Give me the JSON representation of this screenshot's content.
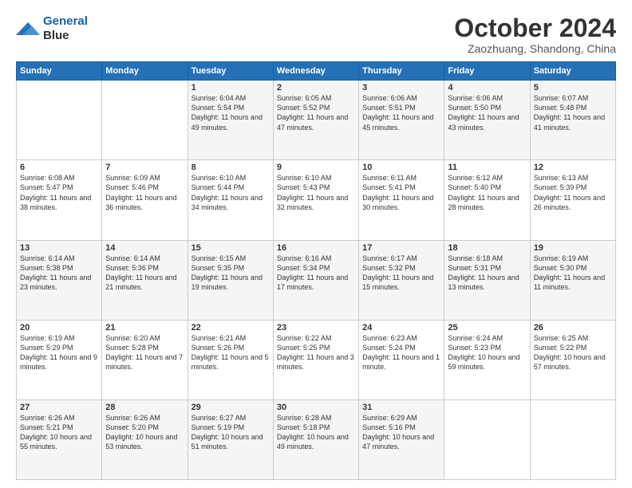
{
  "header": {
    "logo_line1": "General",
    "logo_line2": "Blue",
    "month": "October 2024",
    "location": "Zaozhuang, Shandong, China"
  },
  "weekdays": [
    "Sunday",
    "Monday",
    "Tuesday",
    "Wednesday",
    "Thursday",
    "Friday",
    "Saturday"
  ],
  "weeks": [
    [
      {
        "day": "",
        "info": ""
      },
      {
        "day": "",
        "info": ""
      },
      {
        "day": "1",
        "info": "Sunrise: 6:04 AM\nSunset: 5:54 PM\nDaylight: 11 hours and 49 minutes."
      },
      {
        "day": "2",
        "info": "Sunrise: 6:05 AM\nSunset: 5:52 PM\nDaylight: 11 hours and 47 minutes."
      },
      {
        "day": "3",
        "info": "Sunrise: 6:06 AM\nSunset: 5:51 PM\nDaylight: 11 hours and 45 minutes."
      },
      {
        "day": "4",
        "info": "Sunrise: 6:06 AM\nSunset: 5:50 PM\nDaylight: 11 hours and 43 minutes."
      },
      {
        "day": "5",
        "info": "Sunrise: 6:07 AM\nSunset: 5:48 PM\nDaylight: 11 hours and 41 minutes."
      }
    ],
    [
      {
        "day": "6",
        "info": "Sunrise: 6:08 AM\nSunset: 5:47 PM\nDaylight: 11 hours and 38 minutes."
      },
      {
        "day": "7",
        "info": "Sunrise: 6:09 AM\nSunset: 5:46 PM\nDaylight: 11 hours and 36 minutes."
      },
      {
        "day": "8",
        "info": "Sunrise: 6:10 AM\nSunset: 5:44 PM\nDaylight: 11 hours and 34 minutes."
      },
      {
        "day": "9",
        "info": "Sunrise: 6:10 AM\nSunset: 5:43 PM\nDaylight: 11 hours and 32 minutes."
      },
      {
        "day": "10",
        "info": "Sunrise: 6:11 AM\nSunset: 5:41 PM\nDaylight: 11 hours and 30 minutes."
      },
      {
        "day": "11",
        "info": "Sunrise: 6:12 AM\nSunset: 5:40 PM\nDaylight: 11 hours and 28 minutes."
      },
      {
        "day": "12",
        "info": "Sunrise: 6:13 AM\nSunset: 5:39 PM\nDaylight: 11 hours and 26 minutes."
      }
    ],
    [
      {
        "day": "13",
        "info": "Sunrise: 6:14 AM\nSunset: 5:38 PM\nDaylight: 11 hours and 23 minutes."
      },
      {
        "day": "14",
        "info": "Sunrise: 6:14 AM\nSunset: 5:36 PM\nDaylight: 11 hours and 21 minutes."
      },
      {
        "day": "15",
        "info": "Sunrise: 6:15 AM\nSunset: 5:35 PM\nDaylight: 11 hours and 19 minutes."
      },
      {
        "day": "16",
        "info": "Sunrise: 6:16 AM\nSunset: 5:34 PM\nDaylight: 11 hours and 17 minutes."
      },
      {
        "day": "17",
        "info": "Sunrise: 6:17 AM\nSunset: 5:32 PM\nDaylight: 11 hours and 15 minutes."
      },
      {
        "day": "18",
        "info": "Sunrise: 6:18 AM\nSunset: 5:31 PM\nDaylight: 11 hours and 13 minutes."
      },
      {
        "day": "19",
        "info": "Sunrise: 6:19 AM\nSunset: 5:30 PM\nDaylight: 11 hours and 11 minutes."
      }
    ],
    [
      {
        "day": "20",
        "info": "Sunrise: 6:19 AM\nSunset: 5:29 PM\nDaylight: 11 hours and 9 minutes."
      },
      {
        "day": "21",
        "info": "Sunrise: 6:20 AM\nSunset: 5:28 PM\nDaylight: 11 hours and 7 minutes."
      },
      {
        "day": "22",
        "info": "Sunrise: 6:21 AM\nSunset: 5:26 PM\nDaylight: 11 hours and 5 minutes."
      },
      {
        "day": "23",
        "info": "Sunrise: 6:22 AM\nSunset: 5:25 PM\nDaylight: 11 hours and 3 minutes."
      },
      {
        "day": "24",
        "info": "Sunrise: 6:23 AM\nSunset: 5:24 PM\nDaylight: 11 hours and 1 minute."
      },
      {
        "day": "25",
        "info": "Sunrise: 6:24 AM\nSunset: 5:23 PM\nDaylight: 10 hours and 59 minutes."
      },
      {
        "day": "26",
        "info": "Sunrise: 6:25 AM\nSunset: 5:22 PM\nDaylight: 10 hours and 57 minutes."
      }
    ],
    [
      {
        "day": "27",
        "info": "Sunrise: 6:26 AM\nSunset: 5:21 PM\nDaylight: 10 hours and 55 minutes."
      },
      {
        "day": "28",
        "info": "Sunrise: 6:26 AM\nSunset: 5:20 PM\nDaylight: 10 hours and 53 minutes."
      },
      {
        "day": "29",
        "info": "Sunrise: 6:27 AM\nSunset: 5:19 PM\nDaylight: 10 hours and 51 minutes."
      },
      {
        "day": "30",
        "info": "Sunrise: 6:28 AM\nSunset: 5:18 PM\nDaylight: 10 hours and 49 minutes."
      },
      {
        "day": "31",
        "info": "Sunrise: 6:29 AM\nSunset: 5:16 PM\nDaylight: 10 hours and 47 minutes."
      },
      {
        "day": "",
        "info": ""
      },
      {
        "day": "",
        "info": ""
      }
    ]
  ]
}
